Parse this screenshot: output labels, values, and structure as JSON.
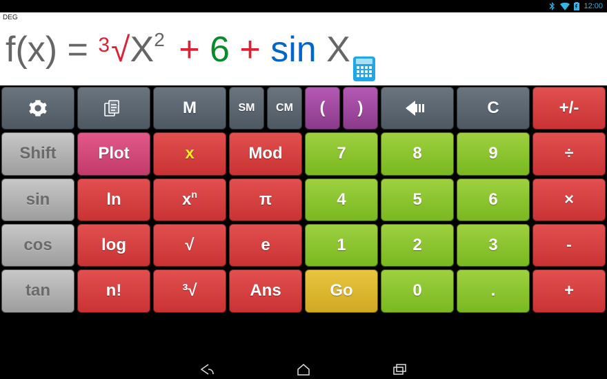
{
  "status": {
    "time": "12:00"
  },
  "display": {
    "mode": "DEG",
    "expr": {
      "fx": "f(x)",
      "eq": " = ",
      "root_idx": "3",
      "sqrt": "√",
      "X1": "X",
      "exp2": "2",
      "plus1": " + ",
      "six": "6",
      "plus2": " + ",
      "sin": "sin ",
      "X2": "X"
    }
  },
  "keys": {
    "M": "M",
    "SM": "SM",
    "CM": "CM",
    "lpar": "(",
    "rpar": ")",
    "C": "C",
    "plusminus": "+/-",
    "shift": "Shift",
    "plot": "Plot",
    "x": "x",
    "mod": "Mod",
    "7": "7",
    "8": "8",
    "9": "9",
    "div": "÷",
    "sin": "sin",
    "ln": "ln",
    "xpow_base": "x",
    "xpow_exp": "n",
    "pi": "π",
    "4": "4",
    "5": "5",
    "6": "6",
    "mul": "×",
    "cos": "cos",
    "log": "log",
    "sqrt": "√",
    "e": "e",
    "1": "1",
    "2": "2",
    "3": "3",
    "minus": "-",
    "tan": "tan",
    "fact": "n!",
    "cbrt": "³√",
    "ans": "Ans",
    "go": "Go",
    "0": "0",
    "dot": ".",
    "plus": "+"
  }
}
